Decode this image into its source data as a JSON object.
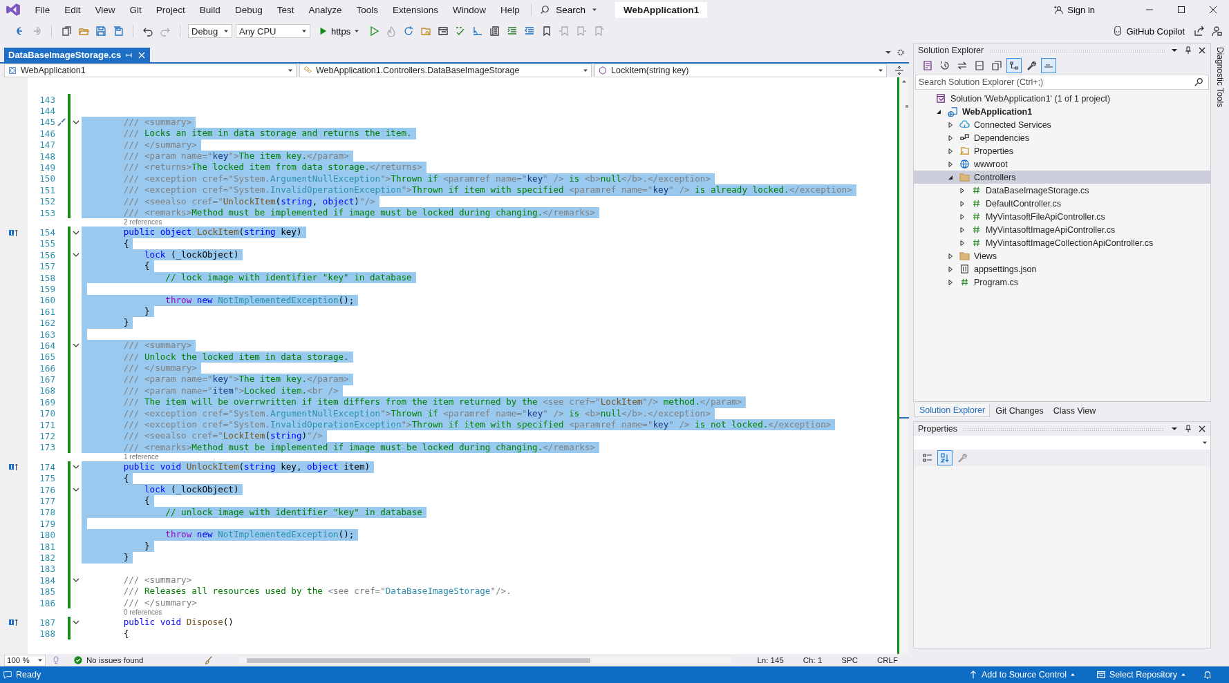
{
  "menu": {
    "items": [
      "File",
      "Edit",
      "View",
      "Git",
      "Project",
      "Build",
      "Debug",
      "Test",
      "Analyze",
      "Tools",
      "Extensions",
      "Window",
      "Help"
    ],
    "search": "Search",
    "solution_name": "WebApplication1",
    "sign_in": "Sign in"
  },
  "toolbar": {
    "configuration": "Debug",
    "platform": "Any CPU",
    "run_target": "https",
    "copilot": "GitHub Copilot"
  },
  "document_tabs": [
    {
      "label": "DataBaseImageStorage.cs",
      "selected": true
    }
  ],
  "navigation_bar": {
    "project": "WebApplication1",
    "type": "WebApplication1.Controllers.DataBaseImageStorage",
    "member": "LockItem(string key)"
  },
  "editor": {
    "lines": [
      {
        "kind": "code",
        "number": "143",
        "selected": false,
        "fold": false
      },
      {
        "kind": "code",
        "number": "144",
        "selected": false,
        "fold": false
      },
      {
        "kind": "code",
        "number": "145",
        "selected": true,
        "fold": true,
        "glyph": {
          "kind": "quick-actions"
        },
        "tokens": [
          {
            "kind": "doc",
            "text": "        /// <summary>"
          }
        ]
      },
      {
        "kind": "code",
        "number": "146",
        "selected": true,
        "fold": false,
        "tokens": [
          {
            "kind": "doc",
            "text": "        /// "
          },
          {
            "kind": "text",
            "text": "Locks an item in data storage and returns the item."
          }
        ]
      },
      {
        "kind": "code",
        "number": "147",
        "selected": true,
        "fold": false,
        "tokens": [
          {
            "kind": "doc",
            "text": "        /// </summary>"
          }
        ]
      },
      {
        "kind": "code",
        "number": "148",
        "selected": true,
        "fold": false,
        "tokens": [
          {
            "kind": "doc",
            "text": "        /// <param name=\""
          },
          {
            "kind": "attr",
            "text": "key"
          },
          {
            "kind": "doc",
            "text": "\">"
          },
          {
            "kind": "text",
            "text": "The item key."
          },
          {
            "kind": "doc",
            "text": "</param>"
          }
        ]
      },
      {
        "kind": "code",
        "number": "149",
        "selected": true,
        "fold": false,
        "tokens": [
          {
            "kind": "doc",
            "text": "        /// <returns>"
          },
          {
            "kind": "text",
            "text": "The locked item from data storage."
          },
          {
            "kind": "doc",
            "text": "</returns>"
          }
        ]
      },
      {
        "kind": "code",
        "number": "150",
        "selected": true,
        "fold": false,
        "tokens": [
          {
            "kind": "doc",
            "text": "        /// <exception cref=\"System."
          },
          {
            "kind": "type",
            "text": "ArgumentNullException"
          },
          {
            "kind": "doc",
            "text": "\">"
          },
          {
            "kind": "text",
            "text": "Thrown if "
          },
          {
            "kind": "doc",
            "text": "<paramref name=\""
          },
          {
            "kind": "attr",
            "text": "key"
          },
          {
            "kind": "doc",
            "text": "\" />"
          },
          {
            "kind": "text",
            "text": " is "
          },
          {
            "kind": "doc",
            "text": "<b>"
          },
          {
            "kind": "text",
            "text": "null"
          },
          {
            "kind": "doc",
            "text": "</b>.</exception>"
          }
        ]
      },
      {
        "kind": "code",
        "number": "151",
        "selected": true,
        "fold": false,
        "tokens": [
          {
            "kind": "doc",
            "text": "        /// <exception cref=\"System."
          },
          {
            "kind": "type",
            "text": "InvalidOperationException"
          },
          {
            "kind": "doc",
            "text": "\">"
          },
          {
            "kind": "text",
            "text": "Thrown if item with specified "
          },
          {
            "kind": "doc",
            "text": "<paramref name=\""
          },
          {
            "kind": "attr",
            "text": "key"
          },
          {
            "kind": "doc",
            "text": "\" />"
          },
          {
            "kind": "text",
            "text": " is already locked."
          },
          {
            "kind": "doc",
            "text": "</exception>"
          }
        ]
      },
      {
        "kind": "code",
        "number": "152",
        "selected": true,
        "fold": false,
        "tokens": [
          {
            "kind": "doc",
            "text": "        /// <seealso cref=\""
          },
          {
            "kind": "method",
            "text": "UnlockItem"
          },
          {
            "kind": "plain",
            "text": "("
          },
          {
            "kind": "kw",
            "text": "string"
          },
          {
            "kind": "plain",
            "text": ", "
          },
          {
            "kind": "kw",
            "text": "object"
          },
          {
            "kind": "plain",
            "text": ")"
          },
          {
            "kind": "doc",
            "text": "\"/>"
          }
        ]
      },
      {
        "kind": "code",
        "number": "153",
        "selected": true,
        "fold": false,
        "tokens": [
          {
            "kind": "doc",
            "text": "        /// <remarks>"
          },
          {
            "kind": "text",
            "text": "Method must be implemented if image must be locked during changing."
          },
          {
            "kind": "doc",
            "text": "</remarks>"
          }
        ]
      },
      {
        "kind": "codelens",
        "text": "2 references"
      },
      {
        "kind": "code",
        "number": "154",
        "selected": true,
        "fold": true,
        "glyph": {
          "kind": "implements"
        },
        "tokens": [
          {
            "kind": "kw",
            "text": "        public object "
          },
          {
            "kind": "method",
            "text": "LockItem"
          },
          {
            "kind": "plain",
            "text": "("
          },
          {
            "kind": "kw",
            "text": "string"
          },
          {
            "kind": "plain",
            "text": " key)"
          }
        ]
      },
      {
        "kind": "code",
        "number": "155",
        "selected": true,
        "fold": false,
        "tokens": [
          {
            "kind": "plain",
            "text": "        {"
          }
        ]
      },
      {
        "kind": "code",
        "number": "156",
        "selected": true,
        "fold": true,
        "tokens": [
          {
            "kind": "kw",
            "text": "            lock"
          },
          {
            "kind": "plain",
            "text": " (_lockObject)"
          }
        ]
      },
      {
        "kind": "code",
        "number": "157",
        "selected": true,
        "fold": false,
        "tokens": [
          {
            "kind": "plain",
            "text": "            {"
          }
        ]
      },
      {
        "kind": "code",
        "number": "158",
        "selected": true,
        "fold": false,
        "tokens": [
          {
            "kind": "comment",
            "text": "                // lock image with identifier \"key\" in database"
          }
        ]
      },
      {
        "kind": "code",
        "number": "159",
        "selected": true,
        "fold": false
      },
      {
        "kind": "code",
        "number": "160",
        "selected": true,
        "fold": false,
        "tokens": [
          {
            "kind": "ctrl",
            "text": "                throw"
          },
          {
            "kind": "kw",
            "text": " new "
          },
          {
            "kind": "type",
            "text": "NotImplementedException"
          },
          {
            "kind": "plain",
            "text": "();"
          }
        ]
      },
      {
        "kind": "code",
        "number": "161",
        "selected": true,
        "fold": false,
        "tokens": [
          {
            "kind": "plain",
            "text": "            }"
          }
        ]
      },
      {
        "kind": "code",
        "number": "162",
        "selected": true,
        "fold": false,
        "tokens": [
          {
            "kind": "plain",
            "text": "        }"
          }
        ]
      },
      {
        "kind": "code",
        "number": "163",
        "selected": true,
        "fold": false
      },
      {
        "kind": "code",
        "number": "164",
        "selected": true,
        "fold": true,
        "tokens": [
          {
            "kind": "doc",
            "text": "        /// <summary>"
          }
        ]
      },
      {
        "kind": "code",
        "number": "165",
        "selected": true,
        "fold": false,
        "tokens": [
          {
            "kind": "doc",
            "text": "        /// "
          },
          {
            "kind": "text",
            "text": "Unlock the locked item in data storage."
          }
        ]
      },
      {
        "kind": "code",
        "number": "166",
        "selected": true,
        "fold": false,
        "tokens": [
          {
            "kind": "doc",
            "text": "        /// </summary>"
          }
        ]
      },
      {
        "kind": "code",
        "number": "167",
        "selected": true,
        "fold": false,
        "tokens": [
          {
            "kind": "doc",
            "text": "        /// <param name=\""
          },
          {
            "kind": "attr",
            "text": "key"
          },
          {
            "kind": "doc",
            "text": "\">"
          },
          {
            "kind": "text",
            "text": "The item key."
          },
          {
            "kind": "doc",
            "text": "</param>"
          }
        ]
      },
      {
        "kind": "code",
        "number": "168",
        "selected": true,
        "fold": false,
        "tokens": [
          {
            "kind": "doc",
            "text": "        /// <param name=\""
          },
          {
            "kind": "attr",
            "text": "item"
          },
          {
            "kind": "doc",
            "text": "\">"
          },
          {
            "kind": "text",
            "text": "Locked item."
          },
          {
            "kind": "doc",
            "text": "<br />"
          }
        ]
      },
      {
        "kind": "code",
        "number": "169",
        "selected": true,
        "fold": false,
        "tokens": [
          {
            "kind": "doc",
            "text": "        /// "
          },
          {
            "kind": "text",
            "text": "The item will be overrwritten if item differs from the item returned by the "
          },
          {
            "kind": "doc",
            "text": "<see cref=\""
          },
          {
            "kind": "method",
            "text": "LockItem"
          },
          {
            "kind": "doc",
            "text": "\"/>"
          },
          {
            "kind": "text",
            "text": " method."
          },
          {
            "kind": "doc",
            "text": "</param>"
          }
        ]
      },
      {
        "kind": "code",
        "number": "170",
        "selected": true,
        "fold": false,
        "tokens": [
          {
            "kind": "doc",
            "text": "        /// <exception cref=\"System."
          },
          {
            "kind": "type",
            "text": "ArgumentNullException"
          },
          {
            "kind": "doc",
            "text": "\">"
          },
          {
            "kind": "text",
            "text": "Thrown if "
          },
          {
            "kind": "doc",
            "text": "<paramref name=\""
          },
          {
            "kind": "attr",
            "text": "key"
          },
          {
            "kind": "doc",
            "text": "\" />"
          },
          {
            "kind": "text",
            "text": " is "
          },
          {
            "kind": "doc",
            "text": "<b>"
          },
          {
            "kind": "text",
            "text": "null"
          },
          {
            "kind": "doc",
            "text": "</b>.</exception>"
          }
        ]
      },
      {
        "kind": "code",
        "number": "171",
        "selected": true,
        "fold": false,
        "tokens": [
          {
            "kind": "doc",
            "text": "        /// <exception cref=\"System."
          },
          {
            "kind": "type",
            "text": "InvalidOperationException"
          },
          {
            "kind": "doc",
            "text": "\">"
          },
          {
            "kind": "text",
            "text": "Thrown if item with specified "
          },
          {
            "kind": "doc",
            "text": "<paramref name=\""
          },
          {
            "kind": "attr",
            "text": "key"
          },
          {
            "kind": "doc",
            "text": "\" />"
          },
          {
            "kind": "text",
            "text": " is not locked."
          },
          {
            "kind": "doc",
            "text": "</exception>"
          }
        ]
      },
      {
        "kind": "code",
        "number": "172",
        "selected": true,
        "fold": false,
        "tokens": [
          {
            "kind": "doc",
            "text": "        /// <seealso cref=\""
          },
          {
            "kind": "method",
            "text": "LockItem"
          },
          {
            "kind": "plain",
            "text": "("
          },
          {
            "kind": "kw",
            "text": "string"
          },
          {
            "kind": "plain",
            "text": ")"
          },
          {
            "kind": "doc",
            "text": "\"/>"
          }
        ]
      },
      {
        "kind": "code",
        "number": "173",
        "selected": true,
        "fold": false,
        "tokens": [
          {
            "kind": "doc",
            "text": "        /// <remarks>"
          },
          {
            "kind": "text",
            "text": "Method must be implemented if image must be locked during changing."
          },
          {
            "kind": "doc",
            "text": "</remarks>"
          }
        ]
      },
      {
        "kind": "codelens",
        "text": "1 reference"
      },
      {
        "kind": "code",
        "number": "174",
        "selected": true,
        "fold": true,
        "glyph": {
          "kind": "implements"
        },
        "tokens": [
          {
            "kind": "kw",
            "text": "        public void "
          },
          {
            "kind": "method",
            "text": "UnlockItem"
          },
          {
            "kind": "plain",
            "text": "("
          },
          {
            "kind": "kw",
            "text": "string"
          },
          {
            "kind": "plain",
            "text": " key, "
          },
          {
            "kind": "kw",
            "text": "object"
          },
          {
            "kind": "plain",
            "text": " item)"
          }
        ]
      },
      {
        "kind": "code",
        "number": "175",
        "selected": true,
        "fold": false,
        "tokens": [
          {
            "kind": "plain",
            "text": "        {"
          }
        ]
      },
      {
        "kind": "code",
        "number": "176",
        "selected": true,
        "fold": true,
        "tokens": [
          {
            "kind": "kw",
            "text": "            lock"
          },
          {
            "kind": "plain",
            "text": " (_lockObject)"
          }
        ]
      },
      {
        "kind": "code",
        "number": "177",
        "selected": true,
        "fold": false,
        "tokens": [
          {
            "kind": "plain",
            "text": "            {"
          }
        ]
      },
      {
        "kind": "code",
        "number": "178",
        "selected": true,
        "fold": false,
        "tokens": [
          {
            "kind": "comment",
            "text": "                // unlock image with identifier \"key\" in database"
          }
        ]
      },
      {
        "kind": "code",
        "number": "179",
        "selected": true,
        "fold": false
      },
      {
        "kind": "code",
        "number": "180",
        "selected": true,
        "fold": false,
        "tokens": [
          {
            "kind": "ctrl",
            "text": "                throw"
          },
          {
            "kind": "kw",
            "text": " new "
          },
          {
            "kind": "type",
            "text": "NotImplementedException"
          },
          {
            "kind": "plain",
            "text": "();"
          }
        ]
      },
      {
        "kind": "code",
        "number": "181",
        "selected": true,
        "fold": false,
        "tokens": [
          {
            "kind": "plain",
            "text": "            }"
          }
        ]
      },
      {
        "kind": "code",
        "number": "182",
        "selected": true,
        "fold": false,
        "tokens": [
          {
            "kind": "plain",
            "text": "        }"
          }
        ]
      },
      {
        "kind": "code",
        "number": "183",
        "selected": false,
        "fold": false
      },
      {
        "kind": "code",
        "number": "184",
        "selected": false,
        "fold": true,
        "tokens": [
          {
            "kind": "doc",
            "text": "        /// <summary>"
          }
        ]
      },
      {
        "kind": "code",
        "number": "185",
        "selected": false,
        "fold": false,
        "tokens": [
          {
            "kind": "doc",
            "text": "        /// "
          },
          {
            "kind": "text",
            "text": "Releases all resources used by the "
          },
          {
            "kind": "doc",
            "text": "<see cref=\""
          },
          {
            "kind": "type",
            "text": "DataBaseImageStorage"
          },
          {
            "kind": "doc",
            "text": "\"/>."
          }
        ]
      },
      {
        "kind": "code",
        "number": "186",
        "selected": false,
        "fold": false,
        "tokens": [
          {
            "kind": "doc",
            "text": "        /// </summary>"
          }
        ]
      },
      {
        "kind": "codelens",
        "text": "0 references"
      },
      {
        "kind": "code",
        "number": "187",
        "selected": false,
        "fold": true,
        "glyph": {
          "kind": "implements"
        },
        "tokens": [
          {
            "kind": "kw",
            "text": "        public void "
          },
          {
            "kind": "method",
            "text": "Dispose"
          },
          {
            "kind": "plain",
            "text": "()"
          }
        ]
      },
      {
        "kind": "code",
        "number": "188",
        "selected": false,
        "fold": false,
        "tokens": [
          {
            "kind": "plain",
            "text": "        {"
          }
        ]
      }
    ]
  },
  "editor_status": {
    "zoom": "100 %",
    "issues": "No issues found",
    "line": "Ln: 145",
    "column": "Ch: 1",
    "whitespace": "SPC",
    "line_ending": "CRLF"
  },
  "solution_explorer": {
    "title": "Solution Explorer",
    "search": {
      "placeholder": "Search Solution Explorer (Ctrl+;)"
    },
    "tree": [
      {
        "label": "Solution 'WebApplication1' (1 of 1 project)",
        "kind": "solution",
        "selected": false,
        "children": [
          {
            "label": "WebApplication1",
            "kind": "project",
            "expanded": true,
            "selected": false,
            "children": [
              {
                "label": "Connected Services",
                "kind": "service",
                "expanded": false,
                "selected": false
              },
              {
                "label": "Dependencies",
                "kind": "dependencies",
                "expanded": false,
                "selected": false
              },
              {
                "label": "Properties",
                "kind": "properties",
                "expanded": false,
                "selected": false
              },
              {
                "label": "wwwroot",
                "kind": "web",
                "expanded": false,
                "selected": false
              },
              {
                "label": "Controllers",
                "kind": "folder",
                "expanded": true,
                "selected": true,
                "children": [
                  {
                    "label": "DataBaseImageStorage.cs",
                    "kind": "csharp",
                    "expanded": false,
                    "selected": false
                  },
                  {
                    "label": "DefaultController.cs",
                    "kind": "csharp",
                    "expanded": false,
                    "selected": false
                  },
                  {
                    "label": "MyVintasoftFileApiController.cs",
                    "kind": "csharp",
                    "expanded": false,
                    "selected": false
                  },
                  {
                    "label": "MyVintasoftImageApiController.cs",
                    "kind": "csharp",
                    "expanded": false,
                    "selected": false
                  },
                  {
                    "label": "MyVintasoftImageCollectionApiController.cs",
                    "kind": "csharp",
                    "expanded": false,
                    "selected": false
                  }
                ]
              },
              {
                "label": "Views",
                "kind": "folder",
                "expanded": false,
                "selected": false
              },
              {
                "label": "appsettings.json",
                "kind": "json",
                "expanded": false,
                "selected": false
              },
              {
                "label": "Program.cs",
                "kind": "csharp",
                "expanded": false,
                "selected": false
              }
            ]
          }
        ]
      }
    ],
    "tabs": [
      {
        "label": "Solution Explorer",
        "selected": true
      },
      {
        "label": "Git Changes",
        "selected": false
      },
      {
        "label": "Class View",
        "selected": false
      }
    ]
  },
  "properties_panel": {
    "title": "Properties"
  },
  "side_tab": "Diagnostic Tools",
  "status_bar": {
    "state": "Ready",
    "source_control": "Add to Source Control",
    "repository": "Select Repository"
  }
}
